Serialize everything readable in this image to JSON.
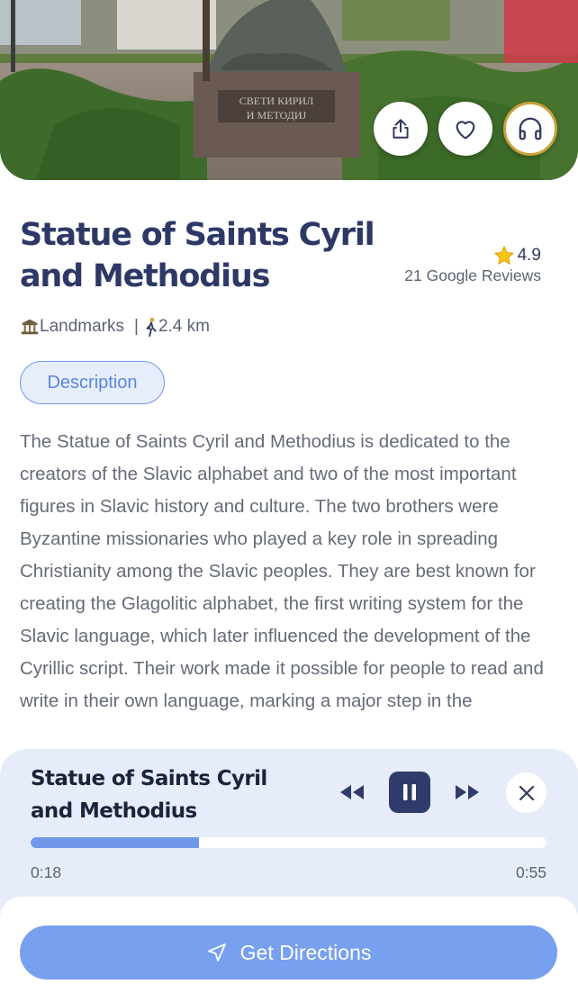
{
  "hero": {
    "image": "Statue of Saints Cyril and Methodius photo",
    "plaque_line1": "СВЕТИ КИРИЛ",
    "plaque_line2": "И МЕТОДИЈ",
    "buttons": {
      "share_icon": "share-icon",
      "favorite_icon": "heart-icon",
      "audio_icon": "headphones-icon"
    },
    "audio_ring_color": "#c9a23a"
  },
  "place": {
    "title": "Statue of Saints Cyril and Methodius",
    "rating": "4.9",
    "reviews": "21 Google Reviews",
    "category_icon": "landmark-icon",
    "category": "Landmarks",
    "separator": "|",
    "distance_icon": "walking-icon",
    "distance": "2.4 km"
  },
  "tabs": {
    "description": "Description"
  },
  "description": "The Statue of Saints Cyril and Methodius is dedicated to the creators of the Slavic alphabet and two of the most important figures in Slavic history and culture. The two brothers were Byzantine missionaries who played a key role in spreading Christianity among the Slavic peoples. They are best known for creating the Glagolitic alphabet, the first writing system for the Slavic language, which later influenced the development of the Cyrillic script. Their work made it possible for people to read and write in their own language, marking a major step in the",
  "player": {
    "title": "Statue of Saints Cyril and Methodius",
    "current_time": "0:18",
    "duration": "0:55",
    "progress": 0.327,
    "controls": [
      "rewind-icon",
      "pause-icon",
      "fast-forward-icon",
      "close-icon"
    ]
  },
  "cta": {
    "label": "Get Directions",
    "icon": "navigation-arrow-icon",
    "color": "#77a0ef"
  },
  "colors": {
    "accent": "#6f97ea",
    "title": "#2d3866",
    "star": "#f5c518"
  }
}
